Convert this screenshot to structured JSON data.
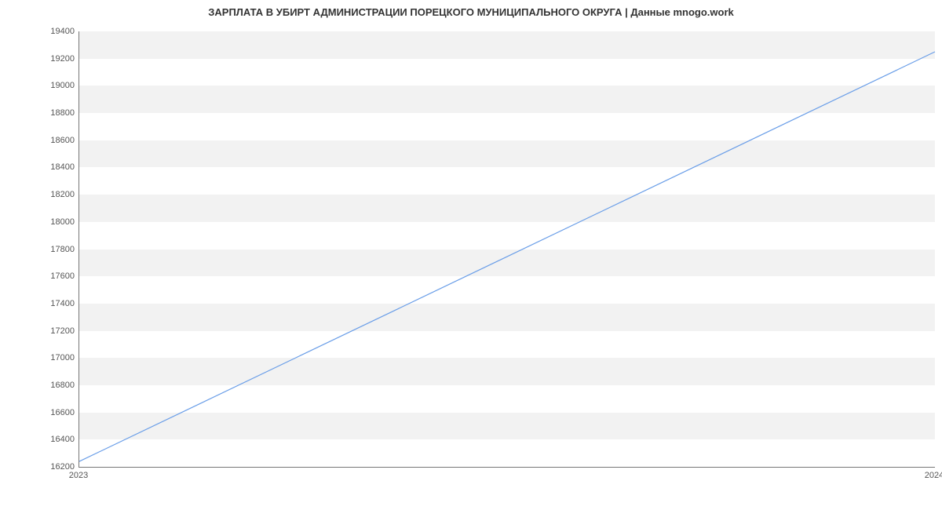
{
  "chart_data": {
    "type": "line",
    "title": "ЗАРПЛАТА В УБИРТ АДМИНИСТРАЦИИ ПОРЕЦКОГО МУНИЦИПАЛЬНОГО ОКРУГА | Данные mnogo.work",
    "x": [
      "2023",
      "2024"
    ],
    "values": [
      16240,
      19250
    ],
    "xlabel": "",
    "ylabel": "",
    "ylim": [
      16200,
      19400
    ],
    "y_ticks": [
      16200,
      16400,
      16600,
      16800,
      17000,
      17200,
      17400,
      17600,
      17800,
      18000,
      18200,
      18400,
      18600,
      18800,
      19000,
      19200,
      19400
    ],
    "x_ticks": [
      "2023",
      "2024"
    ],
    "line_color": "#6a9ee8"
  }
}
